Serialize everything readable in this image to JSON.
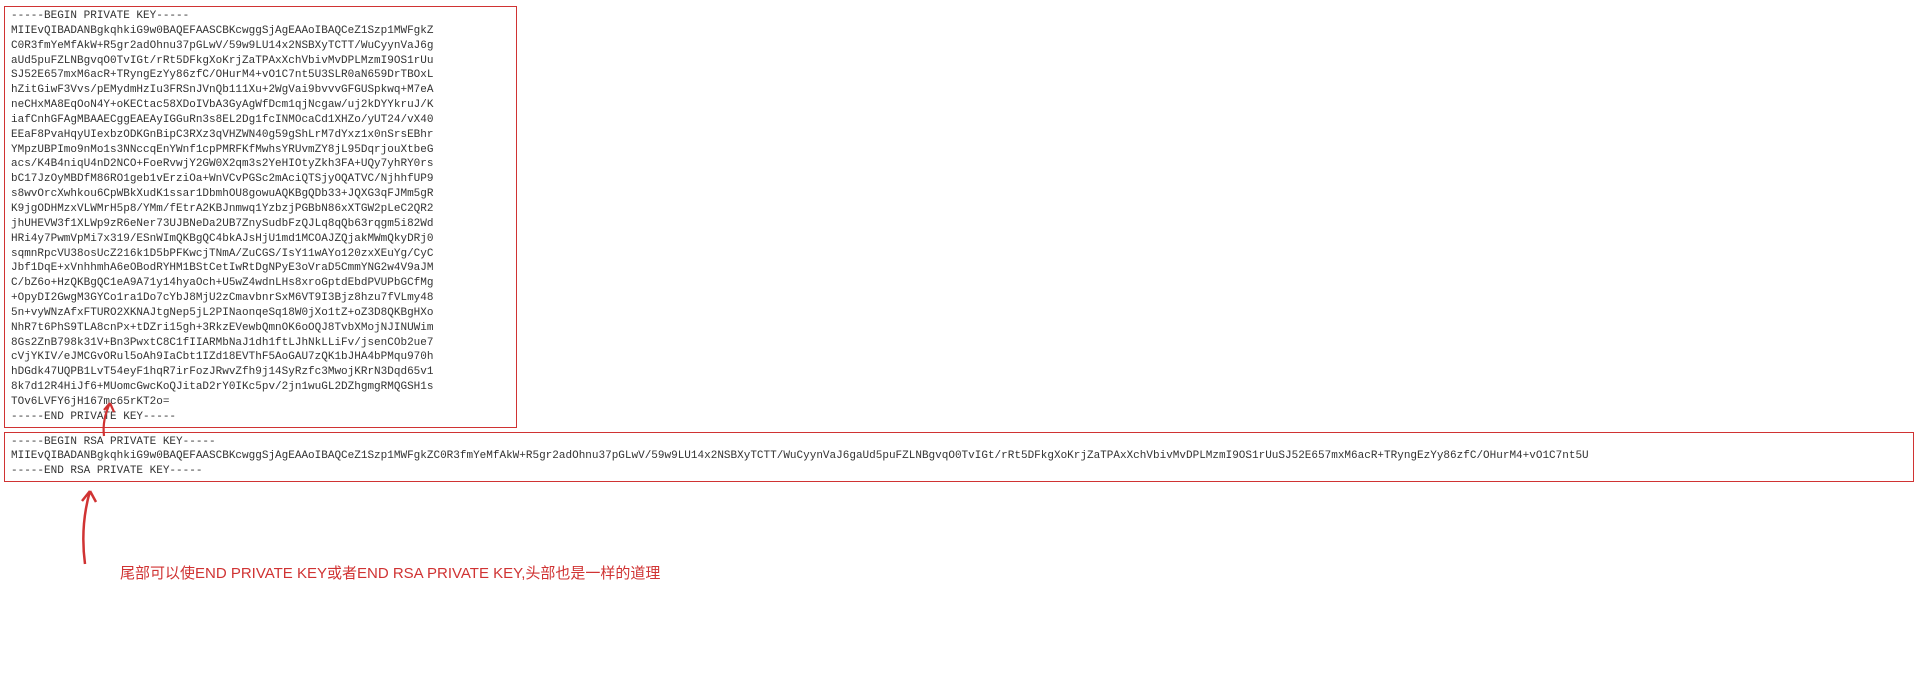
{
  "key1": {
    "begin": "-----BEGIN PRIVATE KEY-----",
    "end": "-----END PRIVATE KEY-----",
    "lines": [
      "MIIEvQIBADANBgkqhkiG9w0BAQEFAASCBKcwggSjAgEAAoIBAQCeZ1Szp1MWFgkZ",
      "C0R3fmYeMfAkW+R5gr2adOhnu37pGLwV/59w9LU14x2NSBXyTCTT/WuCyynVaJ6g",
      "aUd5puFZLNBgvqO0TvIGt/rRt5DFkgXoKrjZaTPAxXchVbivMvDPLMzmI9OS1rUu",
      "SJ52E657mxM6acR+TRyngEzYy86zfC/OHurM4+vO1C7nt5U3SLR0aN659DrTBOxL",
      "hZitGiwF3Vvs/pEMydmHzIu3FRSnJVnQb111Xu+2WgVai9bvvvGFGUSpkwq+M7eA",
      "neCHxMA8EqOoN4Y+oKECtac58XDoIVbA3GyAgWfDcm1qjNcgaw/uj2kDYYkruJ/K",
      "iafCnhGFAgMBAAECggEAEAyIGGuRn3s8EL2Dg1fcINMOcaCd1XHZo/yUT24/vX40",
      "EEaF8PvaHqyUIexbzODKGnBipC3RXz3qVHZWN40g59gShLrM7dYxz1x0nSrsEBhr",
      "YMpzUBPImo9nMo1s3NNccqEnYWnf1cpPMRFKfMwhsYRUvmZY8jL95DqrjouXtbeG",
      "acs/K4B4niqU4nD2NCO+FoeRvwjY2GW0X2qm3s2YeHIOtyZkh3FA+UQy7yhRY0rs",
      "bC17JzOyMBDfM86RO1geb1vErziOa+WnVCvPGSc2mAciQTSjyOQATVC/NjhhfUP9",
      "s8wvOrcXwhkou6CpWBkXudK1ssar1DbmhOU8gowuAQKBgQDb33+JQXG3qFJMm5gR",
      "K9jgODHMzxVLWMrH5p8/YMm/fEtrA2KBJnmwq1YzbzjPGBbN86xXTGW2pLeC2QR2",
      "jhUHEVW3f1XLWp9zR6eNer73UJBNeDa2UB7ZnySudbFzQJLq8qQb63rqgm5i82Wd",
      "HRi4y7PwmVpMi7x319/ESnWImQKBgQC4bkAJsHjU1md1MCOAJZQjakMWmQkyDRj0",
      "sqmnRpcVU38osUcZ216k1D5bPFKwcjTNmA/ZuCGS/IsY11wAYo120zxXEuYg/CyC",
      "Jbf1DqE+xVnhhmhA6eOBodRYHM1BStCetIwRtDgNPyE3oVraD5CmmYNG2w4V9aJM",
      "C/bZ6o+HzQKBgQC1eA9A71y14hyaOch+U5wZ4wdnLHs8xroGptdEbdPVUPbGCfMg",
      "+OpyDI2GwgM3GYCo1ra1Do7cYbJ8MjU2zCmavbnrSxM6VT9I3Bjz8hzu7fVLmy48",
      "5n+vyWNzAfxFTURO2XKNAJtgNep5jL2PINaonqeSq18W0jXo1tZ+oZ3D8QKBgHXo",
      "NhR7t6PhS9TLA8cnPx+tDZri15gh+3RkzEVewbQmnOK6oOQJ8TvbXMojNJINUWim",
      "8Gs2ZnB798k31V+Bn3PwxtC8C1fIIARMbNaJ1dh1ftLJhNkLLiFv/jsenCOb2ue7",
      "cVjYKIV/eJMCGvORul5oAh9IaCbt1IZd18EVThF5AoGAU7zQK1bJHA4bPMqu970h",
      "hDGdk47UQPB1LvT54eyF1hqR7irFozJRwvZfh9j14SyRzfc3MwojKRrN3Dqd65v1",
      "8k7d12R4HiJf6+MUomcGwcKoQJitaD2rY0IKc5pv/2jn1wuGL2DZhgmgRMQGSH1s",
      "TOv6LVFY6jH167mc65rKT2o="
    ]
  },
  "key2": {
    "begin": "-----BEGIN RSA PRIVATE KEY-----",
    "end": "-----END RSA PRIVATE KEY-----",
    "content": "MIIEvQIBADANBgkqhkiG9w0BAQEFAASCBKcwggSjAgEAAoIBAQCeZ1Szp1MWFgkZC0R3fmYeMfAkW+R5gr2adOhnu37pGLwV/59w9LU14x2NSBXyTCTT/WuCyynVaJ6gaUd5puFZLNBgvqO0TvIGt/rRt5DFkgXoKrjZaTPAxXchVbivMvDPLMzmI9OS1rUuSJ52E657mxM6acR+TRyngEzYy86zfC/OHurM4+vO1C7nt5U"
  },
  "annotation": {
    "text": "尾部可以使END PRIVATE KEY或者END RSA PRIVATE KEY,头部也是一样的道理"
  }
}
